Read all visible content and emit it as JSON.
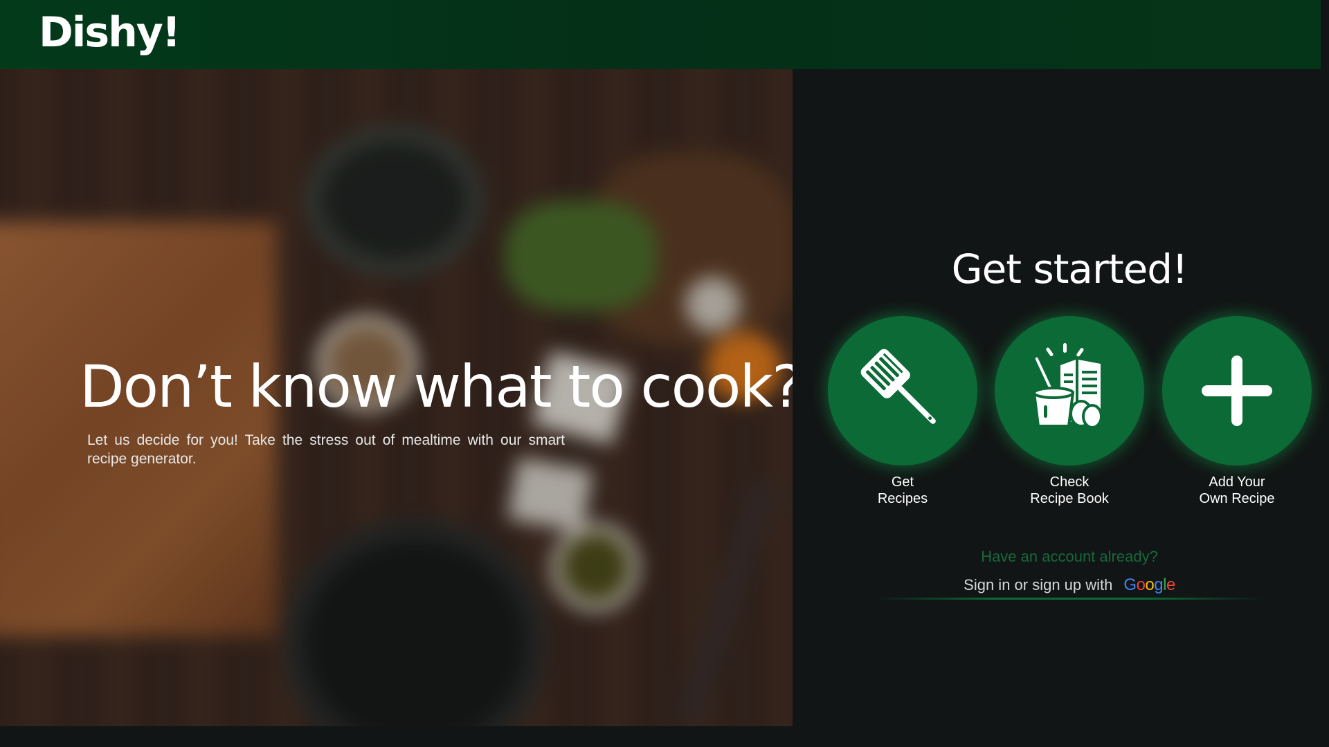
{
  "header": {
    "brand": "Dishy!"
  },
  "hero": {
    "title": "Don’t know what to cook?",
    "subtitle": "Let us decide for you! Take the stress out of mealtime with our smart recipe generator."
  },
  "panel": {
    "title": "Get started!",
    "actions": [
      {
        "label": "Get\nRecipes",
        "icon": "spatula-icon"
      },
      {
        "label": "Check\nRecipe Book",
        "icon": "recipe-book-icon"
      },
      {
        "label": "Add Your\nOwn Recipe",
        "icon": "plus-icon"
      }
    ],
    "account_prompt": "Have an account already?",
    "signin_text": "Sign in or sign up with",
    "google_letters": [
      "G",
      "o",
      "o",
      "g",
      "l",
      "e"
    ]
  },
  "colors": {
    "header_bg": "#033a1a",
    "accent_green": "#0b6a35",
    "page_bg": "#121515"
  }
}
